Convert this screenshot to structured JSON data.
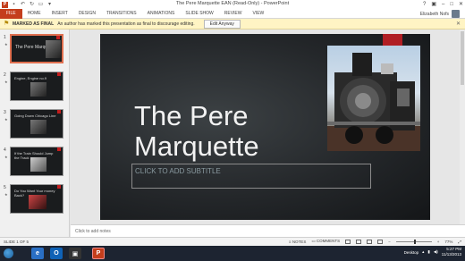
{
  "app": {
    "title": "The Pere Marquette EAN (Read-Only) - PowerPoint",
    "user": "Elizabeth Nofs"
  },
  "ribbon": {
    "tabs": [
      "FILE",
      "HOME",
      "INSERT",
      "DESIGN",
      "TRANSITIONS",
      "ANIMATIONS",
      "SLIDE SHOW",
      "REVIEW",
      "VIEW"
    ]
  },
  "infobar": {
    "label": "MARKED AS FINAL",
    "message": "An author has marked this presentation as final to discourage editing.",
    "button": "Edit Anyway"
  },
  "thumbnails": [
    {
      "num": "1",
      "title": "The Pere Marquette",
      "active": true
    },
    {
      "num": "2",
      "title": "Engine, Engine no.9",
      "active": false
    },
    {
      "num": "3",
      "title": "Going Down Chicago Line",
      "active": false
    },
    {
      "num": "4",
      "title": "If the Train Should Jump the Track",
      "active": false
    },
    {
      "num": "5",
      "title": "Do You Want Your money Back?",
      "active": false
    }
  ],
  "slide": {
    "title_line1": "The Pere",
    "title_line2": "Marquette",
    "subtitle_placeholder": "CLICK TO ADD SUBTITLE"
  },
  "notes": {
    "placeholder": "Click to add notes"
  },
  "status": {
    "slide_info": "SLIDE 1 OF 5",
    "notes_btn": "NOTES",
    "comments_btn": "COMMENTS",
    "zoom": "77%"
  },
  "taskbar": {
    "desktop": "Desktop",
    "time": "5:27 PM",
    "date": "11/13/2013"
  },
  "colors": {
    "accent": "#c43e1c",
    "slide_bg": "#24272a",
    "infobar": "#fff4c4",
    "taskbar": "#1d2431"
  }
}
